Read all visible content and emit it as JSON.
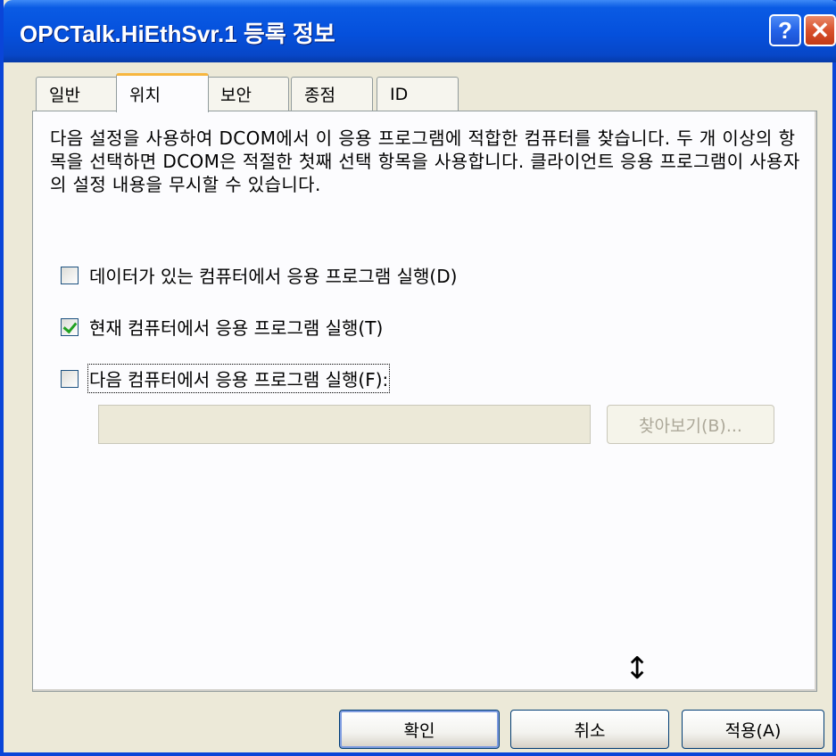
{
  "window": {
    "title": "OPCTalk.HiEthSvr.1 등록 정보",
    "help_glyph": "?",
    "close_glyph": "✕"
  },
  "tabs": [
    {
      "label": "일반",
      "active": false
    },
    {
      "label": "위치",
      "active": true
    },
    {
      "label": "보안",
      "active": false
    },
    {
      "label": "종점",
      "active": false
    },
    {
      "label": "ID",
      "active": false
    }
  ],
  "location": {
    "description": "다음 설정을 사용하여 DCOM에서 이 응용 프로그램에 적합한 컴퓨터를 찾습니다. 두 개 이상의 항목을 선택하면 DCOM은 적절한 첫째 선택 항목을 사용합니다. 클라이언트 응용 프로그램이 사용자의 설정 내용을 무시할 수 있습니다.",
    "options": [
      {
        "label": "데이터가 있는 컴퓨터에서 응용 프로그램 실행(D)",
        "checked": false
      },
      {
        "label": "현재 컴퓨터에서 응용 프로그램 실행(T)",
        "checked": true
      },
      {
        "label": "다음 컴퓨터에서 응용 프로그램 실행(F):",
        "checked": false
      }
    ],
    "computer_name_value": "",
    "browse_label": "찾아보기(B)..."
  },
  "footer": {
    "ok_label": "확인",
    "cancel_label": "취소",
    "apply_label": "적용(A)"
  },
  "cursor": {
    "icon": "resize-vertical-cursor-icon",
    "glyph": "↕"
  },
  "colors": {
    "title_bar": "#0550DC",
    "dialog_bg": "#ECE9D8",
    "panel_bg": "#FCFCFE",
    "active_tab_highlight": "#F7B63E",
    "close_button": "#D9512C",
    "check_mark": "#21A121"
  }
}
